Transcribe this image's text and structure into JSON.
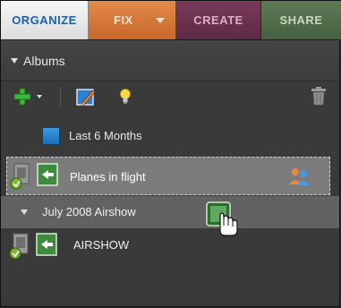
{
  "tabs": {
    "organize": "ORGANIZE",
    "fix": "FIX",
    "create": "CREATE",
    "share": "SHARE"
  },
  "albums_panel": {
    "header_label": "Albums",
    "toolbar": {
      "add_icon": "plus-icon",
      "add_menu_icon": "chevron-down-icon",
      "edit_icon": "edit-album-icon",
      "tip_icon": "lightbulb-icon",
      "delete_icon": "trash-icon"
    },
    "items": [
      {
        "label": "Last 6 Months",
        "icon": "smart-album-icon"
      },
      {
        "label": "Planes in flight",
        "icon": "album-icon",
        "shared_icon": "people-icon"
      },
      {
        "label": "July 2008 Airshow",
        "icon": "expand-triangle-icon"
      },
      {
        "label": "AIRSHOW",
        "icon": "album-icon"
      }
    ]
  },
  "colors": {
    "organize_tab": "#dcdcdc",
    "organize_text": "#1a5fb0",
    "fix_tab": "#c8682a",
    "create_tab": "#5e2a45",
    "share_tab": "#476040",
    "panel_bg": "#3a3a3a",
    "selected_row": "#7c7c7c",
    "group_row": "#626262"
  }
}
